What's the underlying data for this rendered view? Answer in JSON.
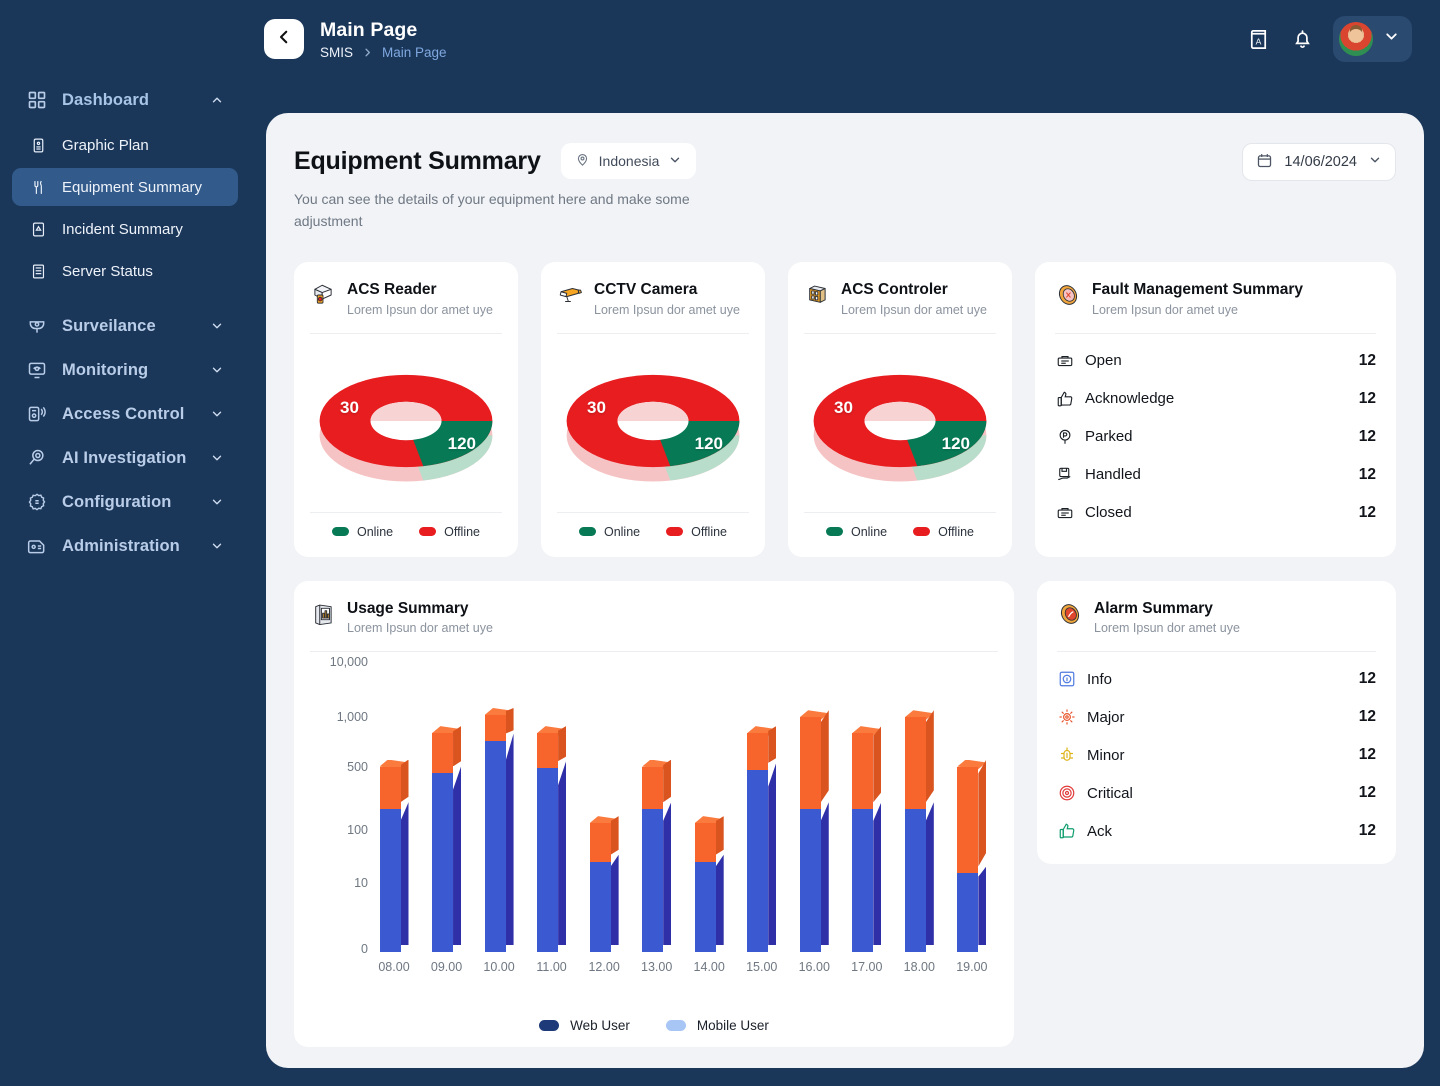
{
  "colors": {
    "sidebar_bg": "#1a3659",
    "panel_bg": "#f1f3f6",
    "accent_blue": "#7fa8e0",
    "online_green": "#077a55",
    "offline_red": "#e71d20",
    "web_user": "#1e3a78",
    "mobile_user": "#a7c6f5",
    "bar_blue": "#3b5ad1",
    "bar_orange": "#f2622a"
  },
  "sidebar": {
    "groups": [
      {
        "label": "Dashboard",
        "icon": "grid-icon",
        "expanded": true,
        "active": true,
        "children": [
          {
            "label": "Graphic Plan",
            "icon": "clipboard-icon",
            "selected": false
          },
          {
            "label": "Equipment Summary",
            "icon": "tools-icon",
            "selected": true
          },
          {
            "label": "Incident Summary",
            "icon": "incident-icon",
            "selected": false
          },
          {
            "label": "Server Status",
            "icon": "server-icon",
            "selected": false
          }
        ]
      },
      {
        "label": "Surveilance",
        "icon": "cctv-icon",
        "expanded": false,
        "children": []
      },
      {
        "label": "Monitoring",
        "icon": "monitor-eye-icon",
        "expanded": false,
        "children": []
      },
      {
        "label": "Access Control",
        "icon": "access-card-icon",
        "expanded": false,
        "children": []
      },
      {
        "label": "AI Investigation",
        "icon": "magnifier-ai-icon",
        "expanded": false,
        "children": []
      },
      {
        "label": "Configuration",
        "icon": "gear-icon",
        "expanded": false,
        "children": []
      },
      {
        "label": "Administration",
        "icon": "admin-id-icon",
        "expanded": false,
        "children": []
      }
    ]
  },
  "topbar": {
    "back_icon": "chevron-left-icon",
    "title": "Main Page",
    "breadcrumb": {
      "root": "SMIS",
      "current": "Main Page"
    },
    "actions": [
      {
        "name": "dictionary-icon",
        "label": "A"
      },
      {
        "name": "bell-icon",
        "label": ""
      }
    ],
    "profile": {
      "avatar": "user-avatar",
      "chevron": "chevron-down-icon"
    }
  },
  "header": {
    "title": "Equipment Summary",
    "location": {
      "icon": "map-pin-icon",
      "value": "Indonesia",
      "chevron": "chevron-down-icon"
    },
    "subtitle": "You can see the details of your equipment here and make some adjustment",
    "date": {
      "icon": "calendar-icon",
      "value": "14/06/2024",
      "chevron": "chevron-down-icon"
    }
  },
  "equipment_cards": [
    {
      "title": "ACS Reader",
      "subtitle": "Lorem Ipsun dor amet uye",
      "icon": "acs-reader-icon",
      "chart_data": {
        "type": "pie",
        "title": "ACS Reader",
        "labels": [
          "Offline",
          "Online"
        ],
        "values": [
          30,
          120
        ],
        "colors": [
          "#e71d20",
          "#077a55"
        ],
        "legend": [
          "Online",
          "Offline"
        ],
        "legend_position": "bottom"
      }
    },
    {
      "title": "CCTV Camera",
      "subtitle": "Lorem Ipsun dor amet uye",
      "icon": "cctv-camera-icon",
      "chart_data": {
        "type": "pie",
        "title": "CCTV Camera",
        "labels": [
          "Offline",
          "Online"
        ],
        "values": [
          30,
          120
        ],
        "colors": [
          "#e71d20",
          "#077a55"
        ],
        "legend": [
          "Online",
          "Offline"
        ],
        "legend_position": "bottom"
      }
    },
    {
      "title": "ACS Controler",
      "subtitle": "Lorem Ipsun dor amet uye",
      "icon": "acs-controller-icon",
      "chart_data": {
        "type": "pie",
        "title": "ACS Controler",
        "labels": [
          "Offline",
          "Online"
        ],
        "values": [
          30,
          120
        ],
        "colors": [
          "#e71d20",
          "#077a55"
        ],
        "legend": [
          "Online",
          "Offline"
        ],
        "legend_position": "bottom"
      }
    }
  ],
  "fault_management": {
    "title": "Fault Management Summary",
    "subtitle": "Lorem Ipsun dor amet uye",
    "icon": "fault-badge-icon",
    "rows": [
      {
        "icon": "open-ticket-icon",
        "label": "Open",
        "value": "12"
      },
      {
        "icon": "thumbs-up-icon",
        "label": "Acknowledge",
        "value": "12"
      },
      {
        "icon": "parked-icon",
        "label": "Parked",
        "value": "12"
      },
      {
        "icon": "handled-icon",
        "label": "Handled",
        "value": "12"
      },
      {
        "icon": "closed-ticket-icon",
        "label": "Closed",
        "value": "12"
      }
    ]
  },
  "alarm_summary": {
    "title": "Alarm Summary",
    "subtitle": "Lorem Ipsun dor amet uye",
    "icon": "alarm-badge-icon",
    "rows": [
      {
        "icon": "info-icon",
        "label": "Info",
        "value": "12",
        "color": "#4f7ae0"
      },
      {
        "icon": "major-icon",
        "label": "Major",
        "value": "12",
        "color": "#e8542a"
      },
      {
        "icon": "minor-icon",
        "label": "Minor",
        "value": "12",
        "color": "#ddb316"
      },
      {
        "icon": "critical-icon",
        "label": "Critical",
        "value": "12",
        "color": "#e23b3b"
      },
      {
        "icon": "ack-icon",
        "label": "Ack",
        "value": "12",
        "color": "#0f9d6e"
      }
    ]
  },
  "usage_summary": {
    "title": "Usage Summary",
    "subtitle": "Lorem Ipsun dor amet uye",
    "icon": "usage-chart-icon",
    "chart_data": {
      "type": "bar",
      "title": "Usage Summary",
      "stacked": true,
      "xlabel": "",
      "ylabel": "",
      "grid": false,
      "legend_position": "bottom",
      "ytick_labels": [
        "10,000",
        "1,000",
        "500",
        "100",
        "10",
        "0"
      ],
      "ytick_positions_pct": [
        0,
        19,
        36,
        58,
        76,
        100
      ],
      "categories": [
        "08.00",
        "09.00",
        "10.00",
        "11.00",
        "12.00",
        "13.00",
        "14.00",
        "15.00",
        "16.00",
        "17.00",
        "18.00",
        "19.00"
      ],
      "series": [
        {
          "name": "Web User",
          "color": "#3b5ad1",
          "values": [
            170,
            420,
            720,
            480,
            25,
            170,
            25,
            460,
            170,
            170,
            170,
            15
          ]
        },
        {
          "name": "Mobile User",
          "color": "#f2622a",
          "values": [
            330,
            380,
            380,
            320,
            95,
            330,
            95,
            340,
            830,
            630,
            830,
            485
          ]
        }
      ],
      "legend": [
        {
          "label": "Web User",
          "color": "#1e3a78"
        },
        {
          "label": "Mobile User",
          "color": "#a7c6f5"
        }
      ]
    }
  }
}
